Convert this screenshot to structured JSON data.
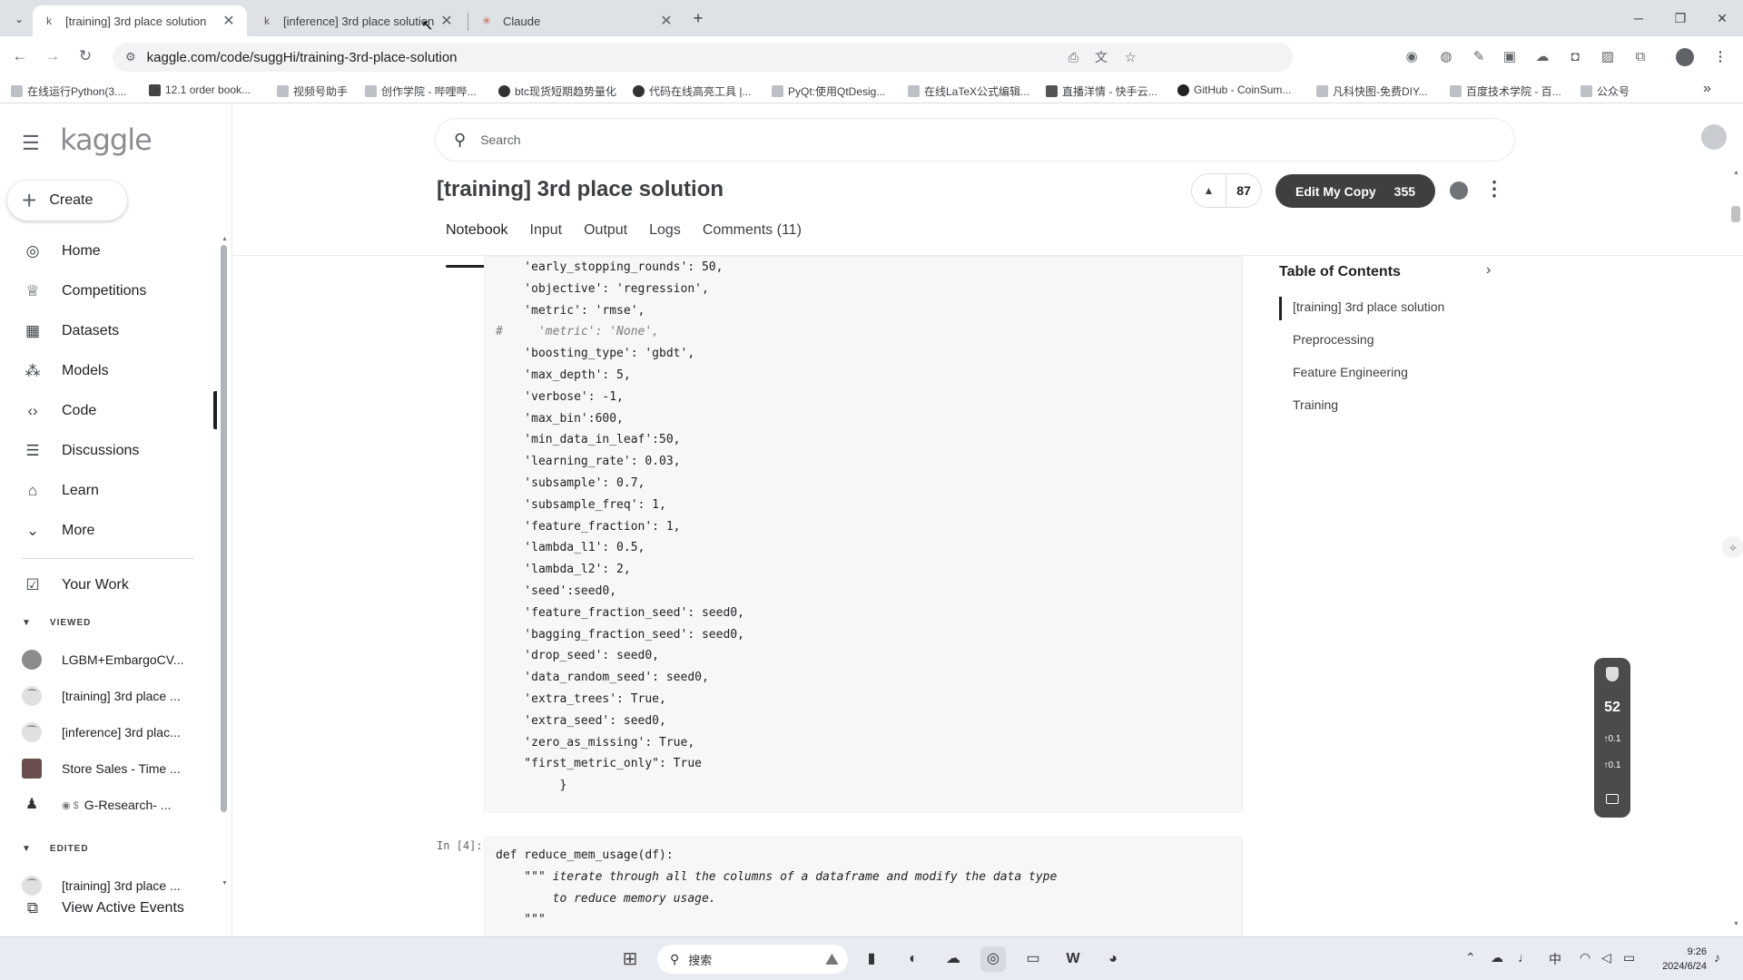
{
  "browser": {
    "tabs": [
      {
        "title": "[training] 3rd place solution",
        "favicon": "k",
        "active": true
      },
      {
        "title": "[inference] 3rd place solution",
        "favicon": "k",
        "active": false
      },
      {
        "title": "Claude",
        "favicon": "✳",
        "active": false
      }
    ],
    "new_tab_icon": "+",
    "url": "kaggle.com/code/suggHi/training-3rd-place-solution",
    "bookmarks": [
      "在线运行Python(3....",
      "12.1 order book...",
      "视频号助手",
      "创作学院 - 哔哩哔...",
      "btc现货短期趋势量化",
      "代码在线高亮工具 |...",
      "PyQt:使用QtDesig...",
      "在线LaTeX公式编辑...",
      "直播洋情 - 快手云...",
      "GitHub - CoinSum...",
      "凡科快图-免费DIY...",
      "百度技术学院 - 百...",
      "公众号"
    ],
    "bookmarks_overflow": "»"
  },
  "kaggle": {
    "logo": "kaggle",
    "create_label": "Create",
    "nav": [
      {
        "label": "Home",
        "icon": "compass-icon"
      },
      {
        "label": "Competitions",
        "icon": "trophy-icon"
      },
      {
        "label": "Datasets",
        "icon": "table-icon"
      },
      {
        "label": "Models",
        "icon": "models-icon"
      },
      {
        "label": "Code",
        "icon": "code-icon"
      },
      {
        "label": "Discussions",
        "icon": "discussion-icon"
      },
      {
        "label": "Learn",
        "icon": "graduation-cap-icon"
      },
      {
        "label": "More",
        "icon": "chevron-down-icon"
      }
    ],
    "your_work": "Your Work",
    "viewed_label": "VIEWED",
    "viewed_items": [
      "LGBM+EmbargoCV...",
      "[training] 3rd place ...",
      "[inference] 3rd plac...",
      "Store Sales - Time ...",
      "G-Research- ..."
    ],
    "edited_label": "EDITED",
    "edited_items": [
      "[training] 3rd place ..."
    ],
    "view_active_events": "View Active Events",
    "search_placeholder": "Search",
    "notebook_title": "[training] 3rd place solution",
    "upvotes": "87",
    "edit_copy_label": "Edit My Copy",
    "edit_copy_count": "355",
    "tabs": [
      "Notebook",
      "Input",
      "Output",
      "Logs",
      "Comments (11)"
    ],
    "active_tab": "Notebook",
    "toc_title": "Table of Contents",
    "toc_items": [
      "[training] 3rd place solution",
      "Preprocessing",
      "Feature Engineering",
      "Training"
    ],
    "cell1_lines": [
      "    'early_stopping_rounds': 50,",
      "    'objective': 'regression',",
      "    'metric': 'rmse',",
      "#     'metric': 'None',",
      "    'boosting_type': 'gbdt',",
      "    'max_depth': 5,",
      "    'verbose': -1,",
      "    'max_bin':600,",
      "    'min_data_in_leaf':50,",
      "    'learning_rate': 0.03,",
      "    'subsample': 0.7,",
      "    'subsample_freq': 1,",
      "    'feature_fraction': 1,",
      "    'lambda_l1': 0.5,",
      "    'lambda_l2': 2,",
      "    'seed':seed0,",
      "    'feature_fraction_seed': seed0,",
      "    'bagging_fraction_seed': seed0,",
      "    'drop_seed': seed0,",
      "    'data_random_seed': seed0,",
      "    'extra_trees': True,",
      "    'extra_seed': seed0,",
      "    'zero_as_missing': True,",
      "    \"first_metric_only\": True",
      "         }"
    ],
    "cell2_prompt": "In [4]:",
    "cell2_lines": [
      "def reduce_mem_usage(df):",
      "    \"\"\" iterate through all the columns of a dataframe and modify the data type",
      "        to reduce memory usage.",
      "    \"\"\""
    ]
  },
  "widget": {
    "score": "52",
    "line1": "↑0.1",
    "line2": "↑0.1"
  },
  "taskbar": {
    "search_label": "搜索",
    "ime": "中",
    "time": "9:26",
    "date": "2024/6/24"
  },
  "colors": {
    "kaggle_blue": "#20beff",
    "button_dark": "#3f3f3f",
    "code_bg": "#f7f7f7"
  }
}
